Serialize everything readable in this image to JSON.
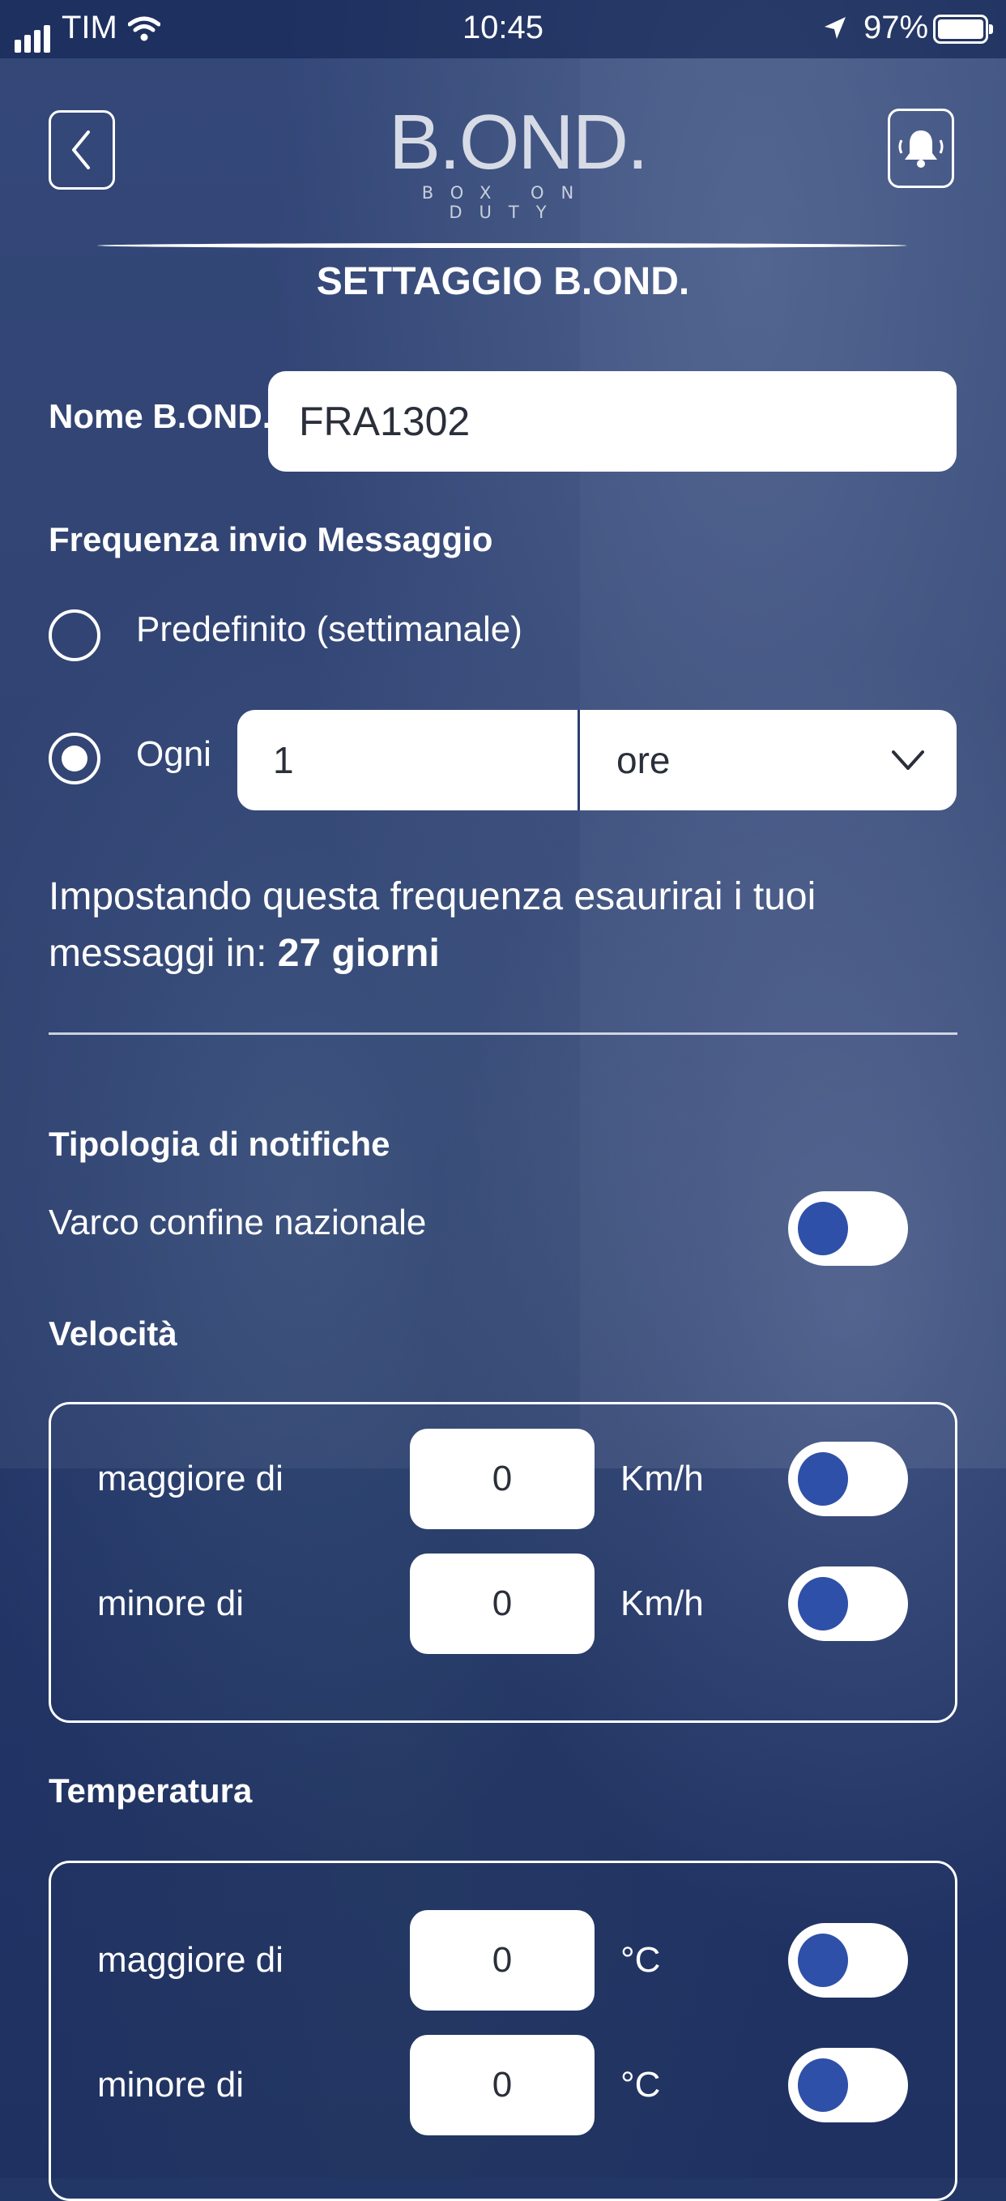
{
  "status_bar": {
    "carrier": "TIM",
    "time": "10:45",
    "battery": "97%"
  },
  "header": {
    "logo_text": "B.OND.",
    "logo_sub": "BOX ON DUTY",
    "title": "SETTAGGIO B.OND."
  },
  "name_field": {
    "label": "Nome B.OND.",
    "value": "FRA1302"
  },
  "frequency": {
    "label": "Frequenza invio Messaggio",
    "option_default": "Predefinito (settimanale)",
    "option_every": "Ogni",
    "every_value": "1",
    "unit_value": "ore",
    "selected": "every"
  },
  "info": {
    "text": "Impostando questa frequenza esaurirai i tuoi",
    "text2": "messaggi in: ",
    "days": "27 giorni"
  },
  "notifications": {
    "label": "Tipologia di notifiche",
    "border_label": "Varco confine nazionale"
  },
  "speed": {
    "label": "Velocità",
    "rows": [
      {
        "label": "maggiore di",
        "value": "0",
        "unit": "Km/h"
      },
      {
        "label": "minore di",
        "value": "0",
        "unit": "Km/h"
      }
    ]
  },
  "temperature": {
    "label": "Temperatura",
    "rows": [
      {
        "label": "maggiore di",
        "value": "0",
        "unit": "°C"
      },
      {
        "label": "minore di",
        "value": "0",
        "unit": "°C"
      }
    ]
  },
  "colors": {
    "background": "#233766",
    "toggle_knob": "#2f50a8",
    "field_text": "#2a2f3a"
  }
}
